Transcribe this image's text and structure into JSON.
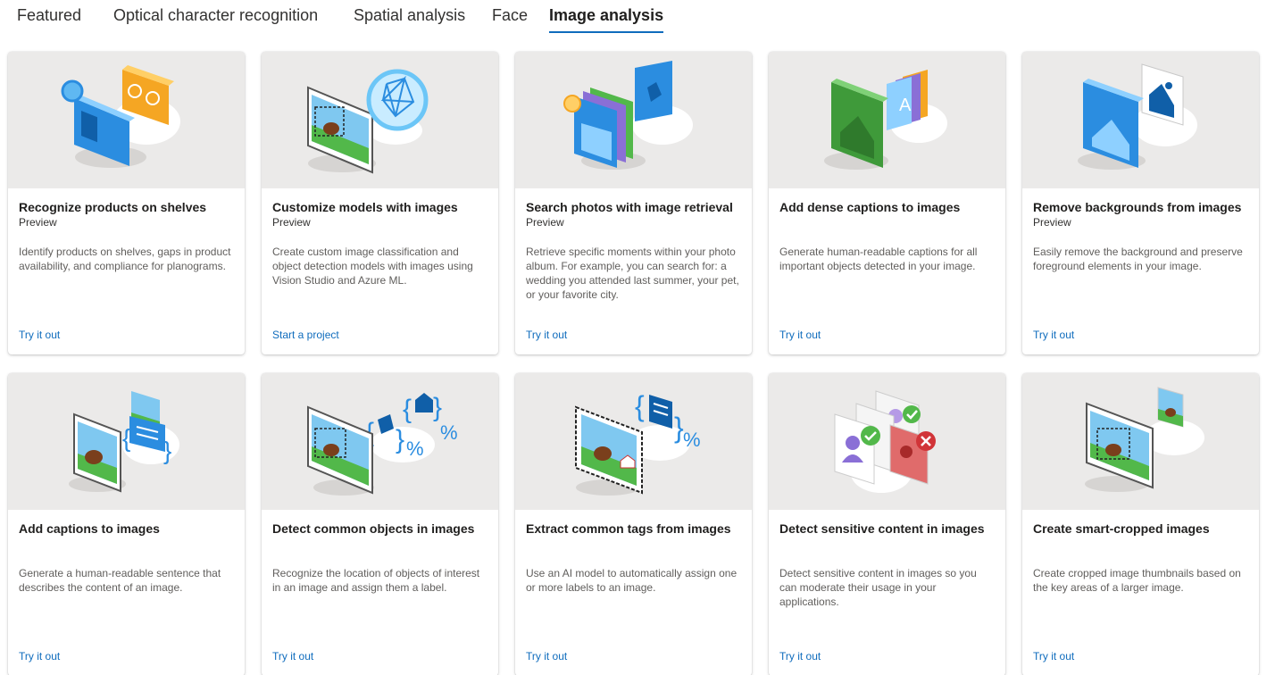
{
  "tabs": [
    {
      "label": "Featured"
    },
    {
      "label": "Optical character recognition"
    },
    {
      "label": "Spatial analysis"
    },
    {
      "label": "Face"
    },
    {
      "label": "Image analysis"
    }
  ],
  "active_tab": "Image analysis",
  "colors": {
    "accent": "#0f6cbd",
    "art_bg": "#ebeae9",
    "link": "#0f6cbd"
  },
  "cards": [
    {
      "icon": "products-on-shelves-illustration",
      "title": "Recognize products on shelves",
      "badge": "Preview",
      "description": "Identify products on shelves, gaps in product availability, and compliance for planograms.",
      "action": "Try it out"
    },
    {
      "icon": "custom-models-illustration",
      "title": "Customize models with images",
      "badge": "Preview",
      "description": "Create custom image classification and object detection models with images using Vision Studio and Azure ML.",
      "action": "Start a project"
    },
    {
      "icon": "image-retrieval-illustration",
      "title": "Search photos with image retrieval",
      "badge": "Preview",
      "description": "Retrieve specific moments within your photo album. For example, you can search for: a wedding you attended last summer, your pet, or your favorite city.",
      "action": "Try it out"
    },
    {
      "icon": "dense-captions-illustration",
      "title": "Add dense captions to images",
      "badge": "",
      "description": "Generate human-readable captions for all important objects detected in your image.",
      "action": "Try it out"
    },
    {
      "icon": "remove-background-illustration",
      "title": "Remove backgrounds from images",
      "badge": "Preview",
      "description": "Easily remove the background and preserve foreground elements in your image.",
      "action": "Try it out"
    },
    {
      "icon": "captions-illustration",
      "title": "Add captions to images",
      "badge": "",
      "description": "Generate a human-readable sentence that describes the content of an image.",
      "action": "Try it out"
    },
    {
      "icon": "object-detection-illustration",
      "title": "Detect common objects in images",
      "badge": "",
      "description": "Recognize the location of objects of interest in an image and assign them a label.",
      "action": "Try it out"
    },
    {
      "icon": "tags-illustration",
      "title": "Extract common tags from images",
      "badge": "",
      "description": "Use an AI model to automatically assign one or more labels to an image.",
      "action": "Try it out"
    },
    {
      "icon": "sensitive-content-illustration",
      "title": "Detect sensitive content in images",
      "badge": "",
      "description": "Detect sensitive content in images so you can moderate their usage in your applications.",
      "action": "Try it out"
    },
    {
      "icon": "smart-crop-illustration",
      "title": "Create smart-cropped images",
      "badge": "",
      "description": "Create cropped image thumbnails based on the key areas of a larger image.",
      "action": "Try it out"
    }
  ]
}
